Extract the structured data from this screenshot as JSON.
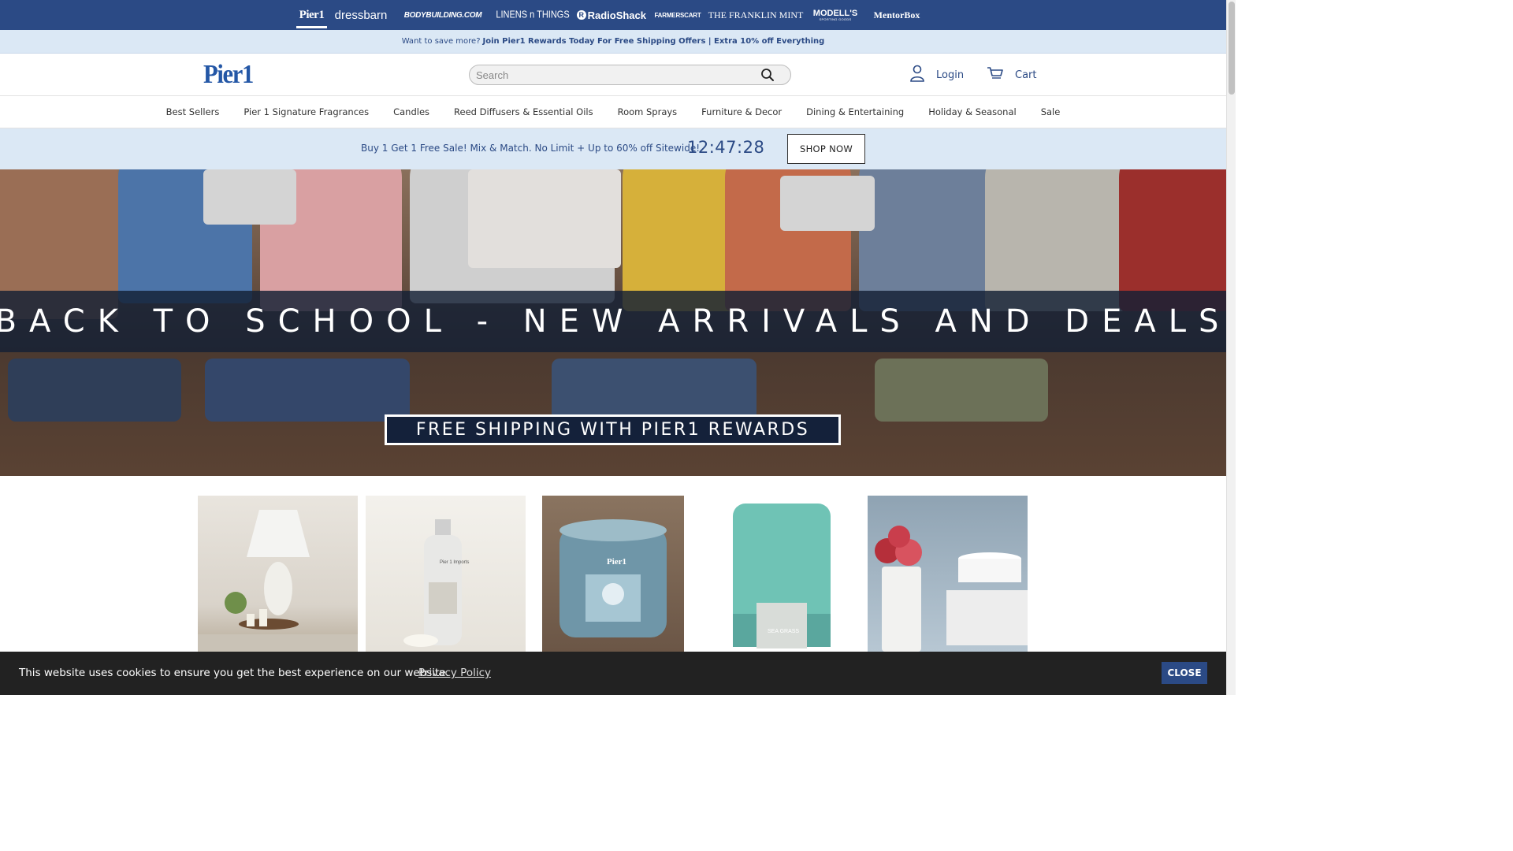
{
  "brands": {
    "pier1": "Pier1",
    "dressbarn": "dressbarn",
    "bodybuilding": "BODYBUILDING.COM",
    "linens": "LINENS n THINGS",
    "radioshack": "RadioShack",
    "farmerscart": "FARMERSCART",
    "franklin": "THE FRANKLIN MINT",
    "modells": "MODELL'S",
    "modells_sub": "SPORTING GOODS",
    "mentorbox": "MentorBox"
  },
  "promo": {
    "lead": "Want to save more?",
    "link": "Join Pier1 Rewards Today For Free Shipping Offers | Extra 10% off Everything"
  },
  "header": {
    "logo": "Pier1",
    "search_placeholder": "Search",
    "login": "Login",
    "cart": "Cart"
  },
  "nav": [
    "Best Sellers",
    "Pier 1 Signature Fragrances",
    "Candles",
    "Reed Diffusers & Essential Oils",
    "Room Sprays",
    "Furniture & Decor",
    "Dining & Entertaining",
    "Holiday & Seasonal",
    "Sale"
  ],
  "sale": {
    "text": "Buy 1 Get 1 Free Sale! Mix & Match. No Limit + Up to 60% off Sitewide!",
    "timer": "12:47:28",
    "button": "SHOP NOW"
  },
  "hero": {
    "title": "BACK TO SCHOOL - NEW ARRIVALS AND DEALS",
    "subtitle": "FREE SHIPPING WITH PIER1 REWARDS"
  },
  "products": [
    {
      "label": ""
    },
    {
      "label": "Pier 1 Imports"
    },
    {
      "label": "Pier1"
    },
    {
      "label": "SEA GRASS"
    },
    {
      "label": ""
    }
  ],
  "cookie": {
    "text": "This website uses cookies to ensure you get the best experience on our website.",
    "link": "Privacy Policy",
    "close": "CLOSE"
  },
  "colors": {
    "brand_blue": "#2b4a85",
    "light_blue": "#dbe8f5",
    "logo_blue": "#2457a6",
    "cookie_bg": "#222222"
  },
  "icons": {
    "search": "search-icon",
    "user": "user-icon",
    "cart": "cart-icon"
  }
}
